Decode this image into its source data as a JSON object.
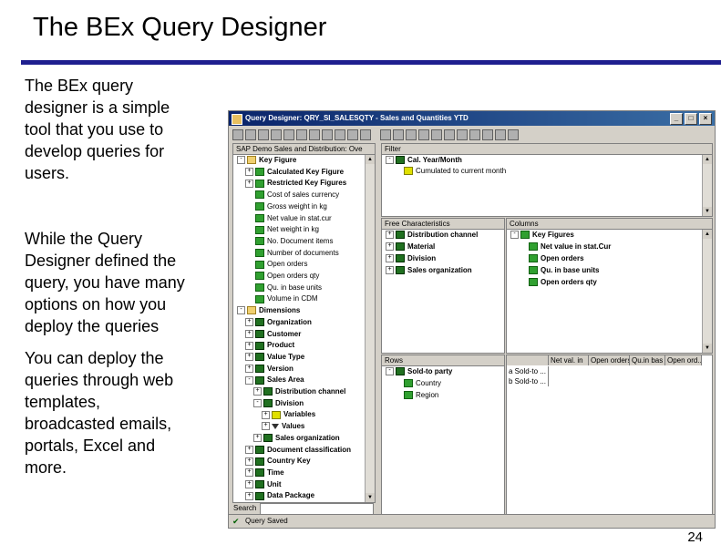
{
  "slide": {
    "title": "The BEx Query Designer",
    "para1": [
      "The BEx query",
      "designer is a simple",
      "tool that you use to",
      "develop queries for",
      "users."
    ],
    "para2": [
      "While the Query",
      "Designer defined the",
      "query, you have many",
      "options on how you",
      "deploy the queries"
    ],
    "para3": [
      "You can deploy the",
      "queries through web",
      "templates,",
      "broadcasted emails,",
      "portals, Excel and",
      "more."
    ],
    "page_number": "24"
  },
  "window": {
    "title": "Query Designer: QRY_SI_SALESQTY - Sales and Quantities YTD",
    "buttons": [
      "_",
      "□",
      "×"
    ]
  },
  "infoprovider": {
    "header": "SAP Demo Sales and Distribution: Ove",
    "items": [
      {
        "label": "Key Figure",
        "bold": true,
        "icon": "folder",
        "level": 0,
        "expander": "-"
      },
      {
        "label": "Calculated Key Figure",
        "bold": true,
        "icon": "kf",
        "level": 1,
        "expander": "+"
      },
      {
        "label": "Restricted Key Figures",
        "bold": true,
        "icon": "kf",
        "level": 1,
        "expander": "+"
      },
      {
        "label": "Cost of sales currency",
        "bold": false,
        "icon": "kf",
        "level": 1,
        "expander": ""
      },
      {
        "label": "Gross weight in kg",
        "bold": false,
        "icon": "kf",
        "level": 1,
        "expander": ""
      },
      {
        "label": "Net value in stat.cur",
        "bold": false,
        "icon": "kf",
        "level": 1,
        "expander": ""
      },
      {
        "label": "Net weight in kg",
        "bold": false,
        "icon": "kf",
        "level": 1,
        "expander": ""
      },
      {
        "label": "No. Document items",
        "bold": false,
        "icon": "kf",
        "level": 1,
        "expander": ""
      },
      {
        "label": "Number of documents",
        "bold": false,
        "icon": "kf",
        "level": 1,
        "expander": ""
      },
      {
        "label": "Open orders",
        "bold": false,
        "icon": "kf",
        "level": 1,
        "expander": ""
      },
      {
        "label": "Open orders qty",
        "bold": false,
        "icon": "kf",
        "level": 1,
        "expander": ""
      },
      {
        "label": "Qu. in base units",
        "bold": false,
        "icon": "kf",
        "level": 1,
        "expander": ""
      },
      {
        "label": "Volume in CDM",
        "bold": false,
        "icon": "kf",
        "level": 1,
        "expander": ""
      },
      {
        "label": "Dimensions",
        "bold": true,
        "icon": "folder",
        "level": 0,
        "expander": "-"
      },
      {
        "label": "Organization",
        "bold": true,
        "icon": "dim",
        "level": 1,
        "expander": "+"
      },
      {
        "label": "Customer",
        "bold": true,
        "icon": "dim",
        "level": 1,
        "expander": "+"
      },
      {
        "label": "Product",
        "bold": true,
        "icon": "dim",
        "level": 1,
        "expander": "+"
      },
      {
        "label": "Value Type",
        "bold": true,
        "icon": "dim",
        "level": 1,
        "expander": "+"
      },
      {
        "label": "Version",
        "bold": true,
        "icon": "dim",
        "level": 1,
        "expander": "+"
      },
      {
        "label": "Sales Area",
        "bold": true,
        "icon": "dim",
        "level": 1,
        "expander": "-"
      },
      {
        "label": "Distribution channel",
        "bold": true,
        "icon": "dim",
        "level": 2,
        "expander": "+"
      },
      {
        "label": "Division",
        "bold": true,
        "icon": "dim",
        "level": 2,
        "expander": "-"
      },
      {
        "label": "Variables",
        "bold": true,
        "icon": "var",
        "level": 3,
        "expander": "+"
      },
      {
        "label": "Values",
        "bold": true,
        "icon": "vals",
        "level": 3,
        "expander": "+"
      },
      {
        "label": "Sales organization",
        "bold": true,
        "icon": "dim",
        "level": 2,
        "expander": "+"
      },
      {
        "label": "Document classification",
        "bold": true,
        "icon": "dim",
        "level": 1,
        "expander": "+"
      },
      {
        "label": "Country Key",
        "bold": true,
        "icon": "dim",
        "level": 1,
        "expander": "+"
      },
      {
        "label": "Time",
        "bold": true,
        "icon": "dim",
        "level": 1,
        "expander": "+"
      },
      {
        "label": "Unit",
        "bold": true,
        "icon": "dim",
        "level": 1,
        "expander": "+"
      },
      {
        "label": "Data Package",
        "bold": true,
        "icon": "dim",
        "level": 1,
        "expander": "+"
      }
    ]
  },
  "filter": {
    "header": "Filter",
    "items": [
      {
        "label": "Cal. Year/Month",
        "bold": true,
        "icon": "dim",
        "level": 0,
        "expander": "-"
      },
      {
        "label": "Cumulated to current month",
        "bold": false,
        "icon": "var",
        "level": 1,
        "expander": ""
      }
    ]
  },
  "free_chars": {
    "header": "Free Characteristics",
    "items": [
      {
        "label": "Distribution channel",
        "bold": true,
        "icon": "dim",
        "level": 0,
        "expander": "+"
      },
      {
        "label": "Material",
        "bold": true,
        "icon": "dim",
        "level": 0,
        "expander": "+"
      },
      {
        "label": "Division",
        "bold": true,
        "icon": "dim",
        "level": 0,
        "expander": "+"
      },
      {
        "label": "Sales organization",
        "bold": true,
        "icon": "dim",
        "level": 0,
        "expander": "+"
      }
    ]
  },
  "columns": {
    "header": "Columns",
    "items": [
      {
        "label": "Key Figures",
        "bold": true,
        "icon": "kf",
        "level": 0,
        "expander": "-"
      },
      {
        "label": "Net value in stat.Cur",
        "bold": true,
        "icon": "kf",
        "level": 1,
        "expander": ""
      },
      {
        "label": "Open orders",
        "bold": true,
        "icon": "kf",
        "level": 1,
        "expander": ""
      },
      {
        "label": "Qu. in base units",
        "bold": true,
        "icon": "kf",
        "level": 1,
        "expander": ""
      },
      {
        "label": "Open orders qty",
        "bold": true,
        "icon": "kf",
        "level": 1,
        "expander": ""
      }
    ]
  },
  "rows": {
    "header": "Rows",
    "items": [
      {
        "label": "Sold-to party",
        "bold": true,
        "icon": "dim",
        "level": 0,
        "expander": "-"
      },
      {
        "label": "Country",
        "bold": false,
        "icon": "kf",
        "level": 1,
        "expander": ""
      },
      {
        "label": "Region",
        "bold": false,
        "icon": "kf",
        "level": 1,
        "expander": ""
      }
    ]
  },
  "preview": {
    "col_headers": [
      "Net val. in",
      "Open orders",
      "Qu.in bas",
      "Open ord..."
    ],
    "row_cells": [
      "a Sold-to ...",
      "b Sold-to ..."
    ]
  },
  "search_label": "Search",
  "status": "Query Saved"
}
